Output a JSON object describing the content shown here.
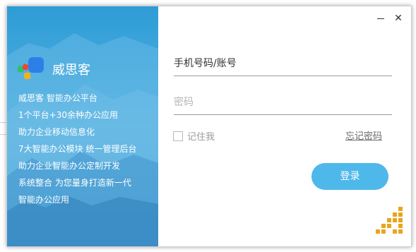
{
  "window": {
    "minimize_glyph": "",
    "close_glyph": "✕"
  },
  "brand": {
    "name": "威思客",
    "icon": "multicolor-blocks-logo"
  },
  "slogans": [
    "威思客  智能办公平台",
    "1个平台+30余种办公应用",
    "助力企业移动信息化",
    "7大智能办公模块  统一管理后台",
    "助力企业智能办公定制开发",
    "系统整合  为您量身打造新一代",
    "智能办公应用"
  ],
  "form": {
    "phone_placeholder": "手机号码/账号",
    "password_placeholder": "密码",
    "remember_label": "记住我",
    "forgot_label": "忘记密码",
    "login_label": "登录"
  },
  "colors": {
    "accent": "#4eb8ea",
    "panel": "#3aa6de"
  }
}
